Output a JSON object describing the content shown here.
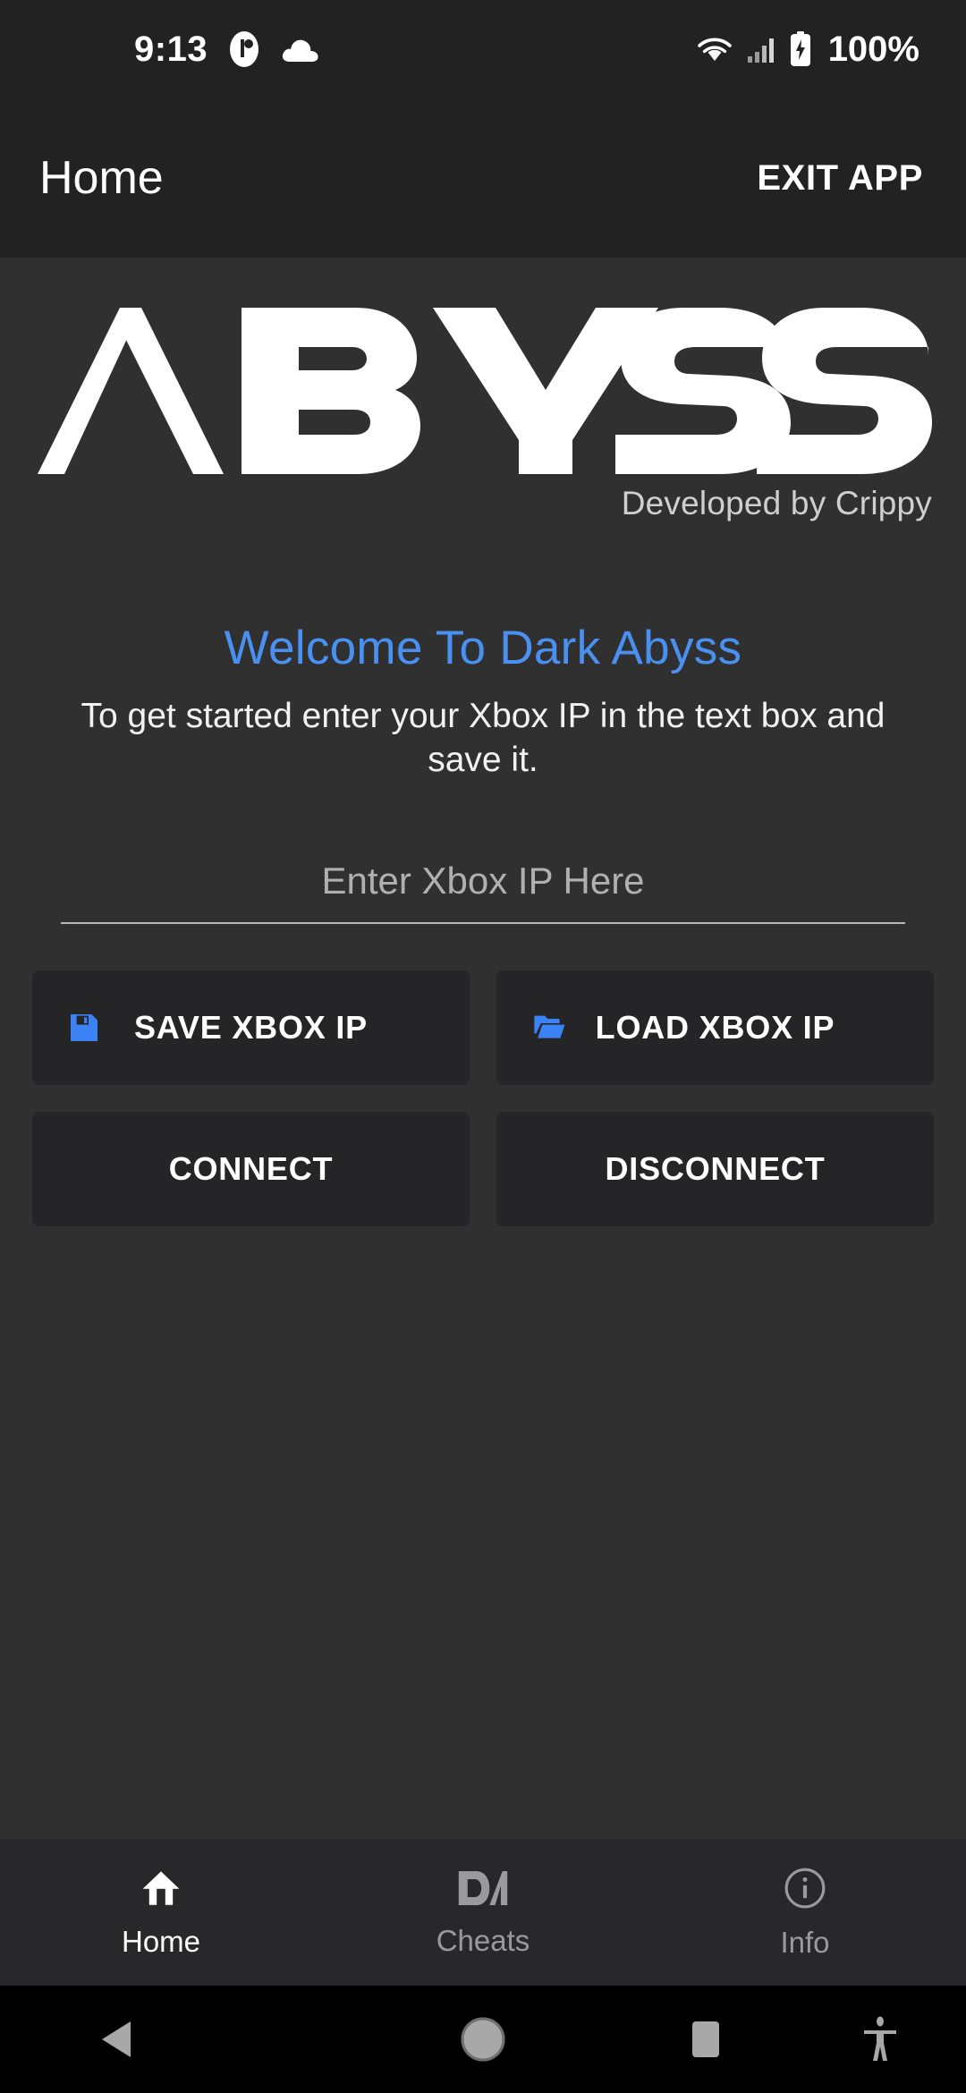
{
  "status_bar": {
    "clock": "9:13",
    "battery_percent": "100%",
    "icons": [
      "notification-badge-icon",
      "cloud-icon",
      "wifi-icon",
      "cellular-signal-icon",
      "battery-charging-icon"
    ]
  },
  "app_bar": {
    "title": "Home",
    "exit_label": "EXIT APP"
  },
  "brand": {
    "logo_text": "ABYSS",
    "credit": "Developed by Crippy"
  },
  "main": {
    "welcome_heading": "Welcome To Dark Abyss",
    "instructions": "To get started enter your Xbox IP in the text box and save it.",
    "ip_input": {
      "value": "",
      "placeholder": "Enter Xbox IP Here"
    },
    "buttons": [
      {
        "label": "SAVE XBOX IP",
        "icon": "floppy-disk-save-icon"
      },
      {
        "label": "LOAD XBOX IP",
        "icon": "open-folder-icon"
      },
      {
        "label": "CONNECT",
        "icon": ""
      },
      {
        "label": "DISCONNECT",
        "icon": ""
      }
    ]
  },
  "bottom_nav": {
    "tabs": [
      {
        "label": "Home",
        "icon": "home-icon",
        "active": true
      },
      {
        "label": "Cheats",
        "icon": "dark-abyss-monogram-icon",
        "active": false
      },
      {
        "label": "Info",
        "icon": "info-circle-icon",
        "active": false
      }
    ]
  },
  "android_nav": {
    "buttons": [
      "back-icon",
      "home-circle-icon",
      "recents-square-icon",
      "accessibility-icon"
    ]
  },
  "colors": {
    "accent_blue": "#4a90f0",
    "icon_blue": "#3b82f6",
    "screen_bg": "#303030",
    "bar_bg": "#222222",
    "button_bg": "#252527",
    "tabbar_bg": "#28282a",
    "muted_text": "#9a9a9e"
  }
}
